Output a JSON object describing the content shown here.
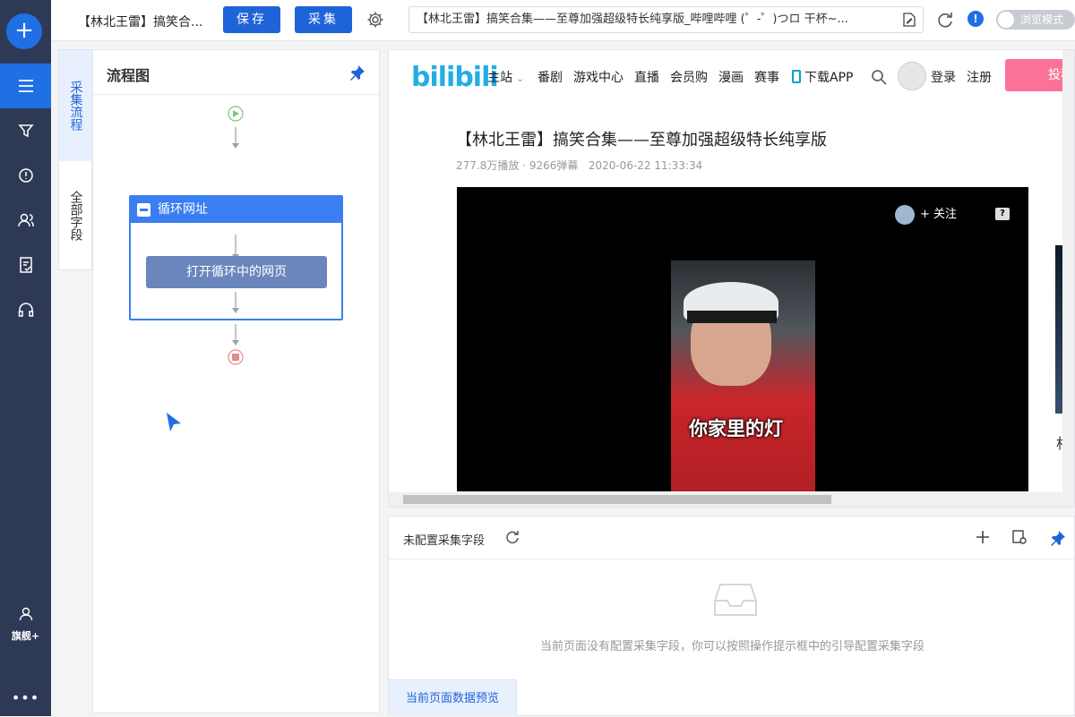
{
  "sidebar": {
    "add_icon": "plus-icon",
    "items": [
      {
        "icon": "menu-icon",
        "active": true
      },
      {
        "icon": "filter-icon",
        "active": false
      },
      {
        "icon": "clock-alert-icon",
        "active": false
      },
      {
        "icon": "users-icon",
        "active": false
      },
      {
        "icon": "document-check-icon",
        "active": false
      },
      {
        "icon": "headset-icon",
        "active": false
      }
    ],
    "user_label": "旗舰+",
    "more_label": "•••"
  },
  "toolbar": {
    "task_title": "【林北王雷】搞笑合...",
    "save_label": "保存",
    "collect_label": "采集",
    "url": "【林北王雷】搞笑合集——至尊加强超级特长纯享版_哔哩哔哩 (゜-゜)つロ 干杯~...",
    "browse_mode_label": "浏览模式",
    "info_label": "!"
  },
  "side_tabs": {
    "flow_tab": "采集流程",
    "fields_tab": "全部字段"
  },
  "flow_panel": {
    "title": "流程图",
    "loop_label": "循环网址",
    "step_label": "打开循环中的网页"
  },
  "bilibili": {
    "logo": "bilibili",
    "nav": [
      "主站",
      "番剧",
      "游戏中心",
      "直播",
      "会员购",
      "漫画",
      "赛事",
      "下载APP"
    ],
    "login": "登录",
    "register": "注册",
    "upload": "投稿",
    "video_title": "【林北王雷】搞笑合集——至尊加强超级特长纯享版",
    "plays": "277.8万播放",
    "danmaku": "9266弹幕",
    "date": "2020-06-22 11:33:34",
    "follow_label": "+ 关注",
    "subtitle": "你家里的灯",
    "side_char": "相"
  },
  "fields_panel": {
    "label": "未配置采集字段",
    "empty_message": "当前页面没有配置采集字段，你可以按照操作提示框中的引导配置采集字段",
    "preview_tab": "当前页面数据预览"
  },
  "colors": {
    "primary": "#1f63d8",
    "rail": "#2e3a55",
    "bili_blue": "#23ade5",
    "bili_pink": "#fb7299"
  }
}
